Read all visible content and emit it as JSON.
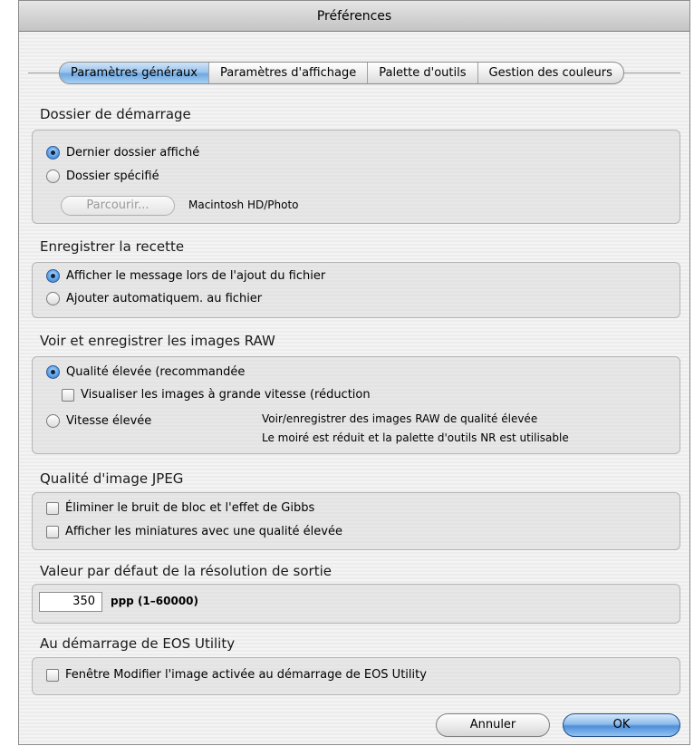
{
  "window": {
    "title": "Préférences"
  },
  "tabs": [
    {
      "label": "Paramètres généraux",
      "active": true
    },
    {
      "label": "Paramètres d'affichage",
      "active": false
    },
    {
      "label": "Palette d'outils",
      "active": false
    },
    {
      "label": "Gestion des couleurs",
      "active": false
    }
  ],
  "startup_folder": {
    "title": "Dossier de démarrage",
    "option_last": "Dernier dossier affiché",
    "option_specified": "Dossier spécifié",
    "selected": "option_last",
    "browse_label": "Parcourir...",
    "path": "Macintosh HD/Photo"
  },
  "save_recipe": {
    "title": "Enregistrer la recette",
    "option_message": "Afficher le message lors de l'ajout du fichier",
    "option_auto": "Ajouter automatiquem. au fichier",
    "selected": "option_message"
  },
  "raw": {
    "title": "Voir et enregistrer les images RAW",
    "option_high_quality": "Qualité élevée (recommandée",
    "checkbox_fast_preview": "Visualiser les images à grande vitesse (réduction",
    "checkbox_fast_preview_checked": false,
    "option_high_speed": "Vitesse élevée",
    "selected": "option_high_quality",
    "info_line1": "Voir/enregistrer des images RAW de qualité élevée",
    "info_line2": "Le moiré est réduit et la palette d'outils NR est utilisable"
  },
  "jpeg": {
    "title": "Qualité d'image JPEG",
    "checkbox_noise": "Éliminer le bruit de bloc et l'effet de Gibbs",
    "checkbox_noise_checked": false,
    "checkbox_thumbnails": "Afficher les miniatures avec une qualité élevée",
    "checkbox_thumbnails_checked": false
  },
  "resolution": {
    "title": "Valeur par défaut de la résolution de sortie",
    "value": "350",
    "unit_label": "ppp (1–60000)"
  },
  "eos_utility": {
    "title": "Au démarrage de EOS Utility",
    "checkbox_label": "Fenêtre Modifier l'image activée au démarrage de EOS Utility",
    "checkbox_checked": false
  },
  "footer": {
    "cancel_label": "Annuler",
    "ok_label": "OK"
  },
  "colors": {
    "accent_blue": "#6fa8e0",
    "window_bg": "#ececec"
  }
}
